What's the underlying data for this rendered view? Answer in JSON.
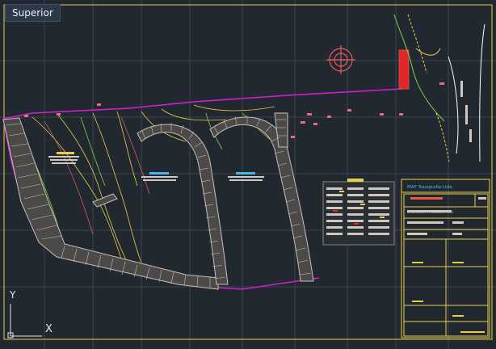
{
  "viewport": {
    "view_label": "Superior",
    "background": "#212830"
  },
  "ucs_icon": {
    "y_label": "Y",
    "x_label": "X"
  },
  "colors": {
    "grid": "#3a4450",
    "boundary": "#d020d0",
    "contour": "#e6d04a",
    "hatch": "#c9c0b5",
    "road": "#7fd640",
    "marker": "#e83030",
    "titleblock": "#e6d04a"
  },
  "title_block": {
    "header": "MAP Topografia Ltda",
    "sheet_label": "LEVANTAMENTO PLANIALTIMETRICO"
  }
}
